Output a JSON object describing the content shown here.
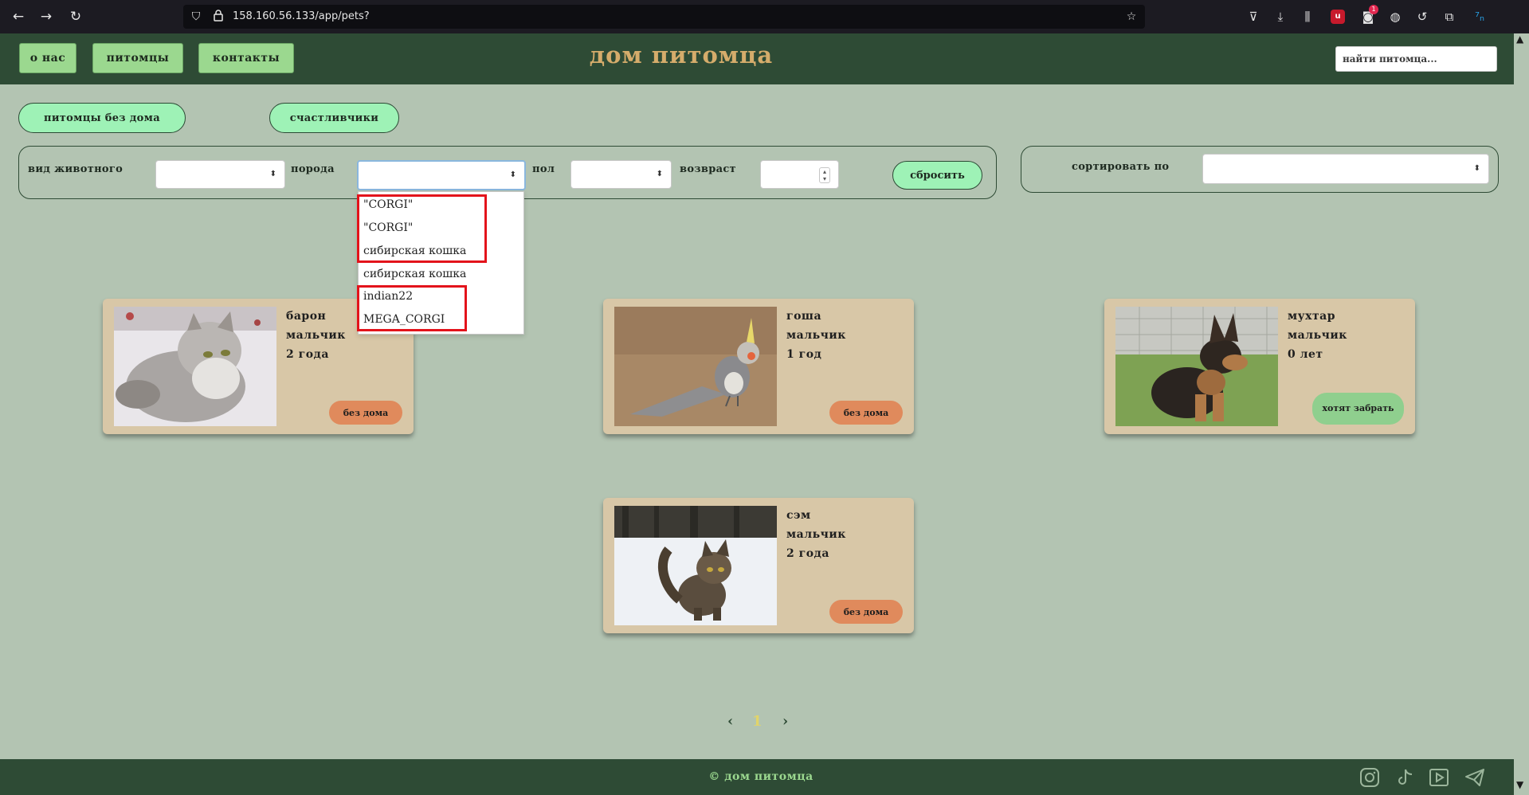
{
  "browser": {
    "url": "158.160.56.133/app/pets?",
    "notification_count": "1"
  },
  "header": {
    "nav": [
      "о нас",
      "питомцы",
      "контакты"
    ],
    "title": "дом питомца",
    "search_placeholder": "найти питомца..."
  },
  "categories": [
    "питомцы без дома",
    "счастливчики"
  ],
  "filters": {
    "animal_type_label": "вид животного",
    "breed_label": "порода",
    "gender_label": "пол",
    "age_label": "возвраст",
    "reset_label": "сбросить",
    "sort_label": "сортировать по"
  },
  "breed_dropdown": {
    "options": [
      "\"CORGI\"",
      "\"CORGI\"",
      "сибирская кошка",
      "сибирская кошка",
      "indian22",
      "MEGA_CORGI"
    ]
  },
  "pets": [
    {
      "name": "барон",
      "gender": "мальчик",
      "age": "2 года",
      "status": "без дома",
      "photo": "siberian-cat-photo"
    },
    {
      "name": "гоша",
      "gender": "мальчик",
      "age": "1 год",
      "status": "без дома",
      "photo": "cockatiel-photo"
    },
    {
      "name": "мухтар",
      "gender": "мальчик",
      "age": "0 лет",
      "status": "хотят забрать",
      "photo": "german-shepherd-puppy-photo"
    },
    {
      "name": "сэм",
      "gender": "мальчик",
      "age": "2 года",
      "status": "без дома",
      "photo": "cat-in-snow-photo"
    }
  ],
  "pagination": {
    "prev": "‹",
    "page": "1",
    "next": "›"
  },
  "footer": {
    "copyright": "© дом питомца",
    "social_icons": [
      "instagram-icon",
      "tiktok-icon",
      "youtube-icon",
      "telegram-icon"
    ]
  },
  "colors": {
    "page_bg": "#b3c4b2",
    "header_bg": "#2e4b35",
    "title": "#d5ac6b",
    "nav_button": "#9bd88f",
    "pill": "#9ef2b6",
    "card_bg": "#d8c7a7",
    "status_homeless": "#e08a5c",
    "status_adopting": "#8fcf8e",
    "highlight": "#e3131b"
  }
}
